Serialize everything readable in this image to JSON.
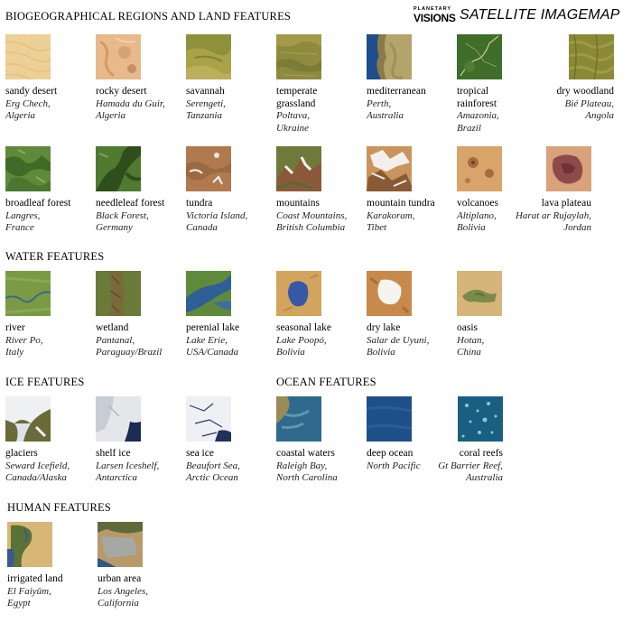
{
  "header": {
    "title": "BIOGEOGRAPHICAL REGIONS AND LAND FEATURES",
    "logo_small": "PLANETARY",
    "logo_big": "VISIONS",
    "logo_text": "SATELLITE IMAGEMAP"
  },
  "sections": {
    "water": "WATER FEATURES",
    "ice": "ICE FEATURES",
    "ocean": "OCEAN FEATURES",
    "human": "HUMAN FEATURES"
  },
  "land": [
    {
      "name": "sandy desert",
      "loc": "Erg Chech,\nAlgeria"
    },
    {
      "name": "rocky desert",
      "loc": "Hamada du Guir,\nAlgeria"
    },
    {
      "name": "savannah",
      "loc": "Serengeti,\nTanzania"
    },
    {
      "name": "temperate\ngrassland",
      "loc": "Poltava,\nUkraine"
    },
    {
      "name": "mediterranean",
      "loc": "Perth,\nAustralia"
    },
    {
      "name": "tropical\nrainforest",
      "loc": "Amazonia,\nBrazil"
    },
    {
      "name": "dry woodland",
      "loc": "Bié Plateau,\nAngola"
    },
    {
      "name": "broadleaf forest",
      "loc": "Langres,\nFrance"
    },
    {
      "name": "needleleaf forest",
      "loc": "Black Forest,\nGermany"
    },
    {
      "name": "tundra",
      "loc": "Victoria Island,\nCanada"
    },
    {
      "name": "mountains",
      "loc": "Coast Mountains,\nBritish Columbia"
    },
    {
      "name": "mountain tundra",
      "loc": "Karakoram,\nTibet"
    },
    {
      "name": "volcanoes",
      "loc": "Altiplano,\nBolivia"
    },
    {
      "name": "lava plateau",
      "loc": "Harat ar Rujaylah,\nJordan"
    }
  ],
  "water": [
    {
      "name": "river",
      "loc": "River Po,\nItaly"
    },
    {
      "name": "wetland",
      "loc": "Pantanal,\nParaguay/Brazil"
    },
    {
      "name": "perenial lake",
      "loc": "Lake Erie,\nUSA/Canada"
    },
    {
      "name": "seasonal lake",
      "loc": "Lake Poopó,\nBolivia"
    },
    {
      "name": "dry lake",
      "loc": "Salar de Uyuni,\nBolivia"
    },
    {
      "name": "oasis",
      "loc": "Hotan,\nChina"
    }
  ],
  "ice": [
    {
      "name": "glaciers",
      "loc": "Seward Icefield,\nCanada/Alaska"
    },
    {
      "name": "shelf ice",
      "loc": "Larsen Iceshelf,\nAntarctica"
    },
    {
      "name": "sea ice",
      "loc": "Beaufort Sea,\nArctic Ocean"
    }
  ],
  "ocean": [
    {
      "name": "coastal waters",
      "loc": "Raleigh Bay,\nNorth Carolina"
    },
    {
      "name": "deep ocean",
      "loc": "North Pacific"
    },
    {
      "name": "coral reefs",
      "loc": "Gt Barrier Reef,\nAustralia"
    }
  ],
  "human": [
    {
      "name": "irrigated land",
      "loc": "El Faiyûm,\nEgypt"
    },
    {
      "name": "urban area",
      "loc": "Los Angeles,\nCalifornia"
    }
  ]
}
